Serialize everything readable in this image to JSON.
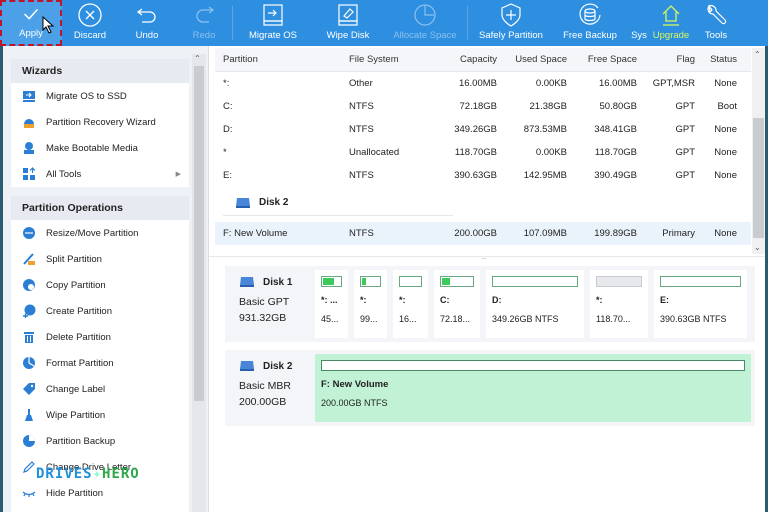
{
  "toolbar": {
    "buttons": [
      {
        "id": "apply",
        "label": "Apply",
        "icon": "check-icon"
      },
      {
        "id": "discard",
        "label": "Discard",
        "icon": "close-circle-icon"
      },
      {
        "id": "undo",
        "label": "Undo",
        "icon": "undo-icon"
      },
      {
        "id": "redo",
        "label": "Redo",
        "icon": "redo-icon"
      },
      {
        "id": "migrate",
        "label": "Migrate OS",
        "icon": "migrate-os-icon"
      },
      {
        "id": "wipe",
        "label": "Wipe Disk",
        "icon": "wipe-disk-icon"
      },
      {
        "id": "allocate",
        "label": "Allocate Space",
        "icon": "pie-clock-icon"
      },
      {
        "id": "safely",
        "label": "Safely Partition",
        "icon": "shield-plus-icon"
      },
      {
        "id": "backup",
        "label": "Free Backup",
        "icon": "database-refresh-icon"
      },
      {
        "id": "sys",
        "label": "Sys"
      },
      {
        "id": "upgrade",
        "label": "Upgrade",
        "icon": "upgrade-house-icon"
      },
      {
        "id": "tools",
        "label": "Tools",
        "icon": "wrench-icon"
      }
    ],
    "upgrade_color": "#d6f75a",
    "bg_color": "#2e8fe0"
  },
  "sidebar": {
    "wizards": {
      "title": "Wizards",
      "items": [
        {
          "label": "Migrate OS to SSD",
          "icon": "migrate-ssd-icon"
        },
        {
          "label": "Partition Recovery Wizard",
          "icon": "partition-recovery-icon"
        },
        {
          "label": "Make Bootable Media",
          "icon": "bootable-media-icon"
        },
        {
          "label": "All Tools",
          "icon": "all-tools-icon",
          "has_submenu": true
        }
      ]
    },
    "operations": {
      "title": "Partition Operations",
      "items": [
        {
          "label": "Resize/Move Partition",
          "icon": "resize-move-icon"
        },
        {
          "label": "Split Partition",
          "icon": "split-icon"
        },
        {
          "label": "Copy Partition",
          "icon": "copy-partition-icon"
        },
        {
          "label": "Create Partition",
          "icon": "create-partition-icon"
        },
        {
          "label": "Delete Partition",
          "icon": "trash-icon"
        },
        {
          "label": "Format Partition",
          "icon": "format-icon"
        },
        {
          "label": "Change Label",
          "icon": "tag-icon"
        },
        {
          "label": "Wipe Partition",
          "icon": "broom-icon"
        },
        {
          "label": "Partition Backup",
          "icon": "pie-backup-icon"
        },
        {
          "label": "Change Drive Letter",
          "icon": "pencil-icon"
        },
        {
          "label": "Hide Partition",
          "icon": "closed-eye-icon"
        }
      ]
    }
  },
  "table": {
    "columns": [
      "Partition",
      "File System",
      "Capacity",
      "Used Space",
      "Free Space",
      "Flag",
      "Status"
    ],
    "disk1_rows": [
      [
        "*:",
        "Other",
        "16.00MB",
        "0.00KB",
        "16.00MB",
        "GPT,MSR",
        "None"
      ],
      [
        "C:",
        "NTFS",
        "72.18GB",
        "21.38GB",
        "50.80GB",
        "GPT",
        "Boot"
      ],
      [
        "D:",
        "NTFS",
        "349.26GB",
        "873.53MB",
        "348.41GB",
        "GPT",
        "None"
      ],
      [
        "*",
        "Unallocated",
        "118.70GB",
        "0.00KB",
        "118.70GB",
        "GPT",
        "None"
      ],
      [
        "E:",
        "NTFS",
        "390.63GB",
        "142.95MB",
        "390.49GB",
        "GPT",
        "None"
      ]
    ],
    "disk2_title": "Disk 2",
    "disk2_rows": [
      [
        "F: New Volume",
        "NTFS",
        "200.00GB",
        "107.09MB",
        "199.89GB",
        "Primary",
        "None"
      ]
    ]
  },
  "diskmap": {
    "disk1": {
      "name": "Disk 1",
      "type": "Basic GPT",
      "size": "931.32GB",
      "partitions": [
        {
          "label": "*: ...",
          "size": "45...",
          "used_fraction": 0.7
        },
        {
          "label": "*:",
          "size": "99...",
          "used_fraction": 0.3
        },
        {
          "label": "*:",
          "size": "16...",
          "used_fraction": 0.0
        },
        {
          "label": "C:",
          "size": "72.18...",
          "used_fraction": 0.3
        },
        {
          "label": "D:",
          "size": "349.26GB NTFS",
          "used_fraction": 0.0
        },
        {
          "label": "*:",
          "size": "118.70...",
          "used_fraction": 0.0,
          "unallocated": true
        },
        {
          "label": "E:",
          "size": "390.63GB NTFS",
          "used_fraction": 0.0
        }
      ]
    },
    "disk2": {
      "name": "Disk 2",
      "type": "Basic MBR",
      "size": "200.00GB",
      "partitions": [
        {
          "label": "F: New Volume",
          "size": "200.00GB NTFS",
          "used_fraction": 0.0,
          "selected": true
        }
      ]
    }
  },
  "watermark": {
    "part1": "DRIVES",
    "part2": "HERO"
  }
}
